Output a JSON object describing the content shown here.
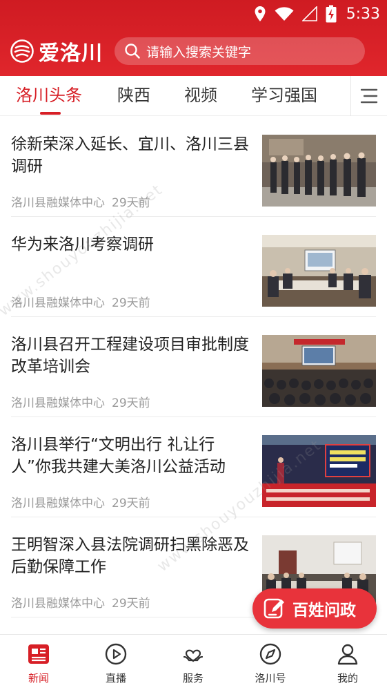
{
  "colors": {
    "brand_red": "#d71f26",
    "header_red": "#e0262c",
    "meta_gray": "#9a9a9a"
  },
  "status_bar": {
    "time": "5:33",
    "icons": [
      "location-icon",
      "wifi-icon",
      "signal-icon",
      "battery-charging-icon"
    ]
  },
  "app": {
    "name": "爱洛川"
  },
  "search": {
    "placeholder": "请输入搜索关键字"
  },
  "tabs": [
    {
      "label": "洛川头条",
      "active": true
    },
    {
      "label": "陕西"
    },
    {
      "label": "视频"
    },
    {
      "label": "学习强国"
    }
  ],
  "news": [
    {
      "title": "徐新荣深入延长、宜川、洛川三县调研",
      "source": "洛川县融媒体中心",
      "time": "29天前"
    },
    {
      "title": "华为来洛川考察调研",
      "source": "洛川县融媒体中心",
      "time": "29天前"
    },
    {
      "title": "洛川县召开工程建设项目审批制度改革培训会",
      "source": "洛川县融媒体中心",
      "time": "29天前"
    },
    {
      "title": "洛川县举行“文明出行 礼让行人”你我共建大美洛川公益活动",
      "source": "洛川县融媒体中心",
      "time": "29天前"
    },
    {
      "title": "王明智深入县法院调研扫黑除恶及后勤保障工作",
      "source": "洛川县融媒体中心",
      "time": "29天前"
    }
  ],
  "fab": {
    "label": "百姓问政"
  },
  "bottom_nav": [
    {
      "label": "新闻",
      "icon": "news-icon",
      "active": true
    },
    {
      "label": "直播",
      "icon": "play-icon"
    },
    {
      "label": "服务",
      "icon": "heart-hand-icon"
    },
    {
      "label": "洛川号",
      "icon": "compass-icon"
    },
    {
      "label": "我的",
      "icon": "user-icon"
    }
  ],
  "watermark": "www.shouyouzhijia.net"
}
